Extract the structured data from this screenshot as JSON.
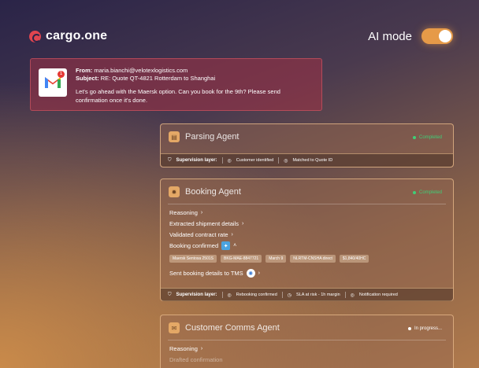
{
  "brand": {
    "name": "cargo.one"
  },
  "ai_mode": {
    "label": "AI mode",
    "enabled": true
  },
  "email": {
    "from_label": "From:",
    "from": "maria.bianchi@velotexlogistics.com",
    "subject_label": "Subject:",
    "subject": "RE: Quote QT-4821 Rotterdam to Shanghai",
    "body": "Let's go ahead with the Maersk option. Can you book for the 9th? Please send confirmation once it's done.",
    "badge": "1"
  },
  "parsing": {
    "name": "Parsing Agent",
    "status": "Completed",
    "supervision_label": "Supervision layer:",
    "checks": [
      "Customer identified",
      "Matched to Quote ID"
    ]
  },
  "booking": {
    "name": "Booking Agent",
    "status": "Completed",
    "items": [
      "Reasoning",
      "Extracted shipment details",
      "Validated contract rate",
      "Booking confirmed"
    ],
    "tags": [
      "Maersk Sentosa 2501S",
      "BKG-MAE-8847721",
      "March 9",
      "NLRTM-CNSHA direct",
      "$1,840/40HC"
    ],
    "sent": "Sent booking details to TMS",
    "supervision_label": "Supervision layer:",
    "checks": [
      "Rebooking confirmed",
      "SLA at risk - 1h margin",
      "Notification required"
    ]
  },
  "comms": {
    "name": "Customer Comms Agent",
    "status": "In progress...",
    "items": [
      "Reasoning",
      "Drafted confirmation"
    ]
  },
  "colors": {
    "accent": "#e69a48",
    "completed": "#3fcf77",
    "brand": "#e0454f"
  }
}
